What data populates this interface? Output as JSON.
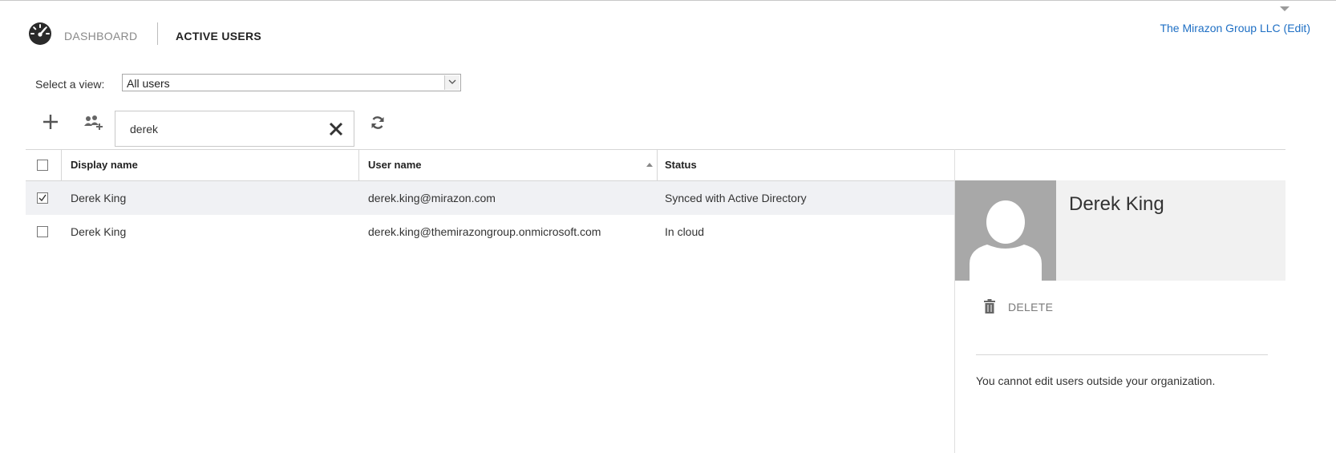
{
  "header": {
    "nav_dashboard": "DASHBOARD",
    "nav_active": "ACTIVE USERS",
    "org_link": "The Mirazon Group LLC (Edit)"
  },
  "view": {
    "label": "Select a view:",
    "selected": "All users"
  },
  "search": {
    "value": "derek"
  },
  "table": {
    "columns": [
      "Display name",
      "User name",
      "Status"
    ],
    "sort_column": "User name",
    "sort_direction": "ascending",
    "rows": [
      {
        "display_name": "Derek King",
        "user_name": "derek.king@mirazon.com",
        "status": "Synced with Active Directory",
        "checked": true,
        "selected": true
      },
      {
        "display_name": "Derek King",
        "user_name": "derek.king@themirazongroup.onmicrosoft.com",
        "status": "In cloud",
        "checked": false,
        "selected": false
      }
    ]
  },
  "panel": {
    "name": "Derek King",
    "delete_label": "DELETE",
    "note": "You cannot edit users outside your organization."
  },
  "icons": {
    "dashboard": "speedometer-icon",
    "add": "plus-icon",
    "bulk": "users-add-icon",
    "clear": "close-icon",
    "refresh": "refresh-icon",
    "delete": "trash-icon",
    "avatar": "person-silhouette-icon"
  },
  "colors": {
    "link": "#1e6fc4",
    "selected_row": "#f0f1f4",
    "avatar_bg": "#a8a8a8"
  }
}
